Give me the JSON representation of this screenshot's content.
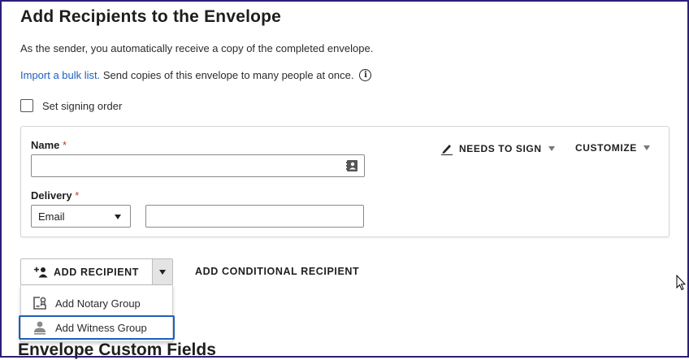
{
  "page": {
    "title": "Add Recipients to the Envelope",
    "subtitle": "As the sender, you automatically receive a copy of the completed envelope.",
    "bulk_link": "Import a bulk list.",
    "bulk_text": " Send copies of this envelope to many people at once.",
    "signing_order_label": "Set signing order",
    "next_section_heading": "Envelope Custom Fields"
  },
  "recipient": {
    "name_label": "Name",
    "name_value": "",
    "delivery_label": "Delivery",
    "required_mark": "*",
    "delivery_selected": "Email",
    "email_value": "",
    "action_label": "NEEDS TO SIGN",
    "customize_label": "CUSTOMIZE"
  },
  "actions": {
    "add_recipient_label": "ADD RECIPIENT",
    "add_conditional_label": "ADD CONDITIONAL RECIPIENT"
  },
  "menu": {
    "items": [
      {
        "label": "Add Notary Group",
        "icon": "notary-icon"
      },
      {
        "label": "Add Witness Group",
        "icon": "witness-icon"
      }
    ]
  },
  "icons": {
    "info": "info-icon",
    "contacts": "contact-book-icon",
    "pen": "pen-icon",
    "add_person": "add-person-icon"
  },
  "colors": {
    "link": "#1f5fbf",
    "required": "#c0392b",
    "frame": "#2a1f7a",
    "focus": "#1f5fbf"
  }
}
